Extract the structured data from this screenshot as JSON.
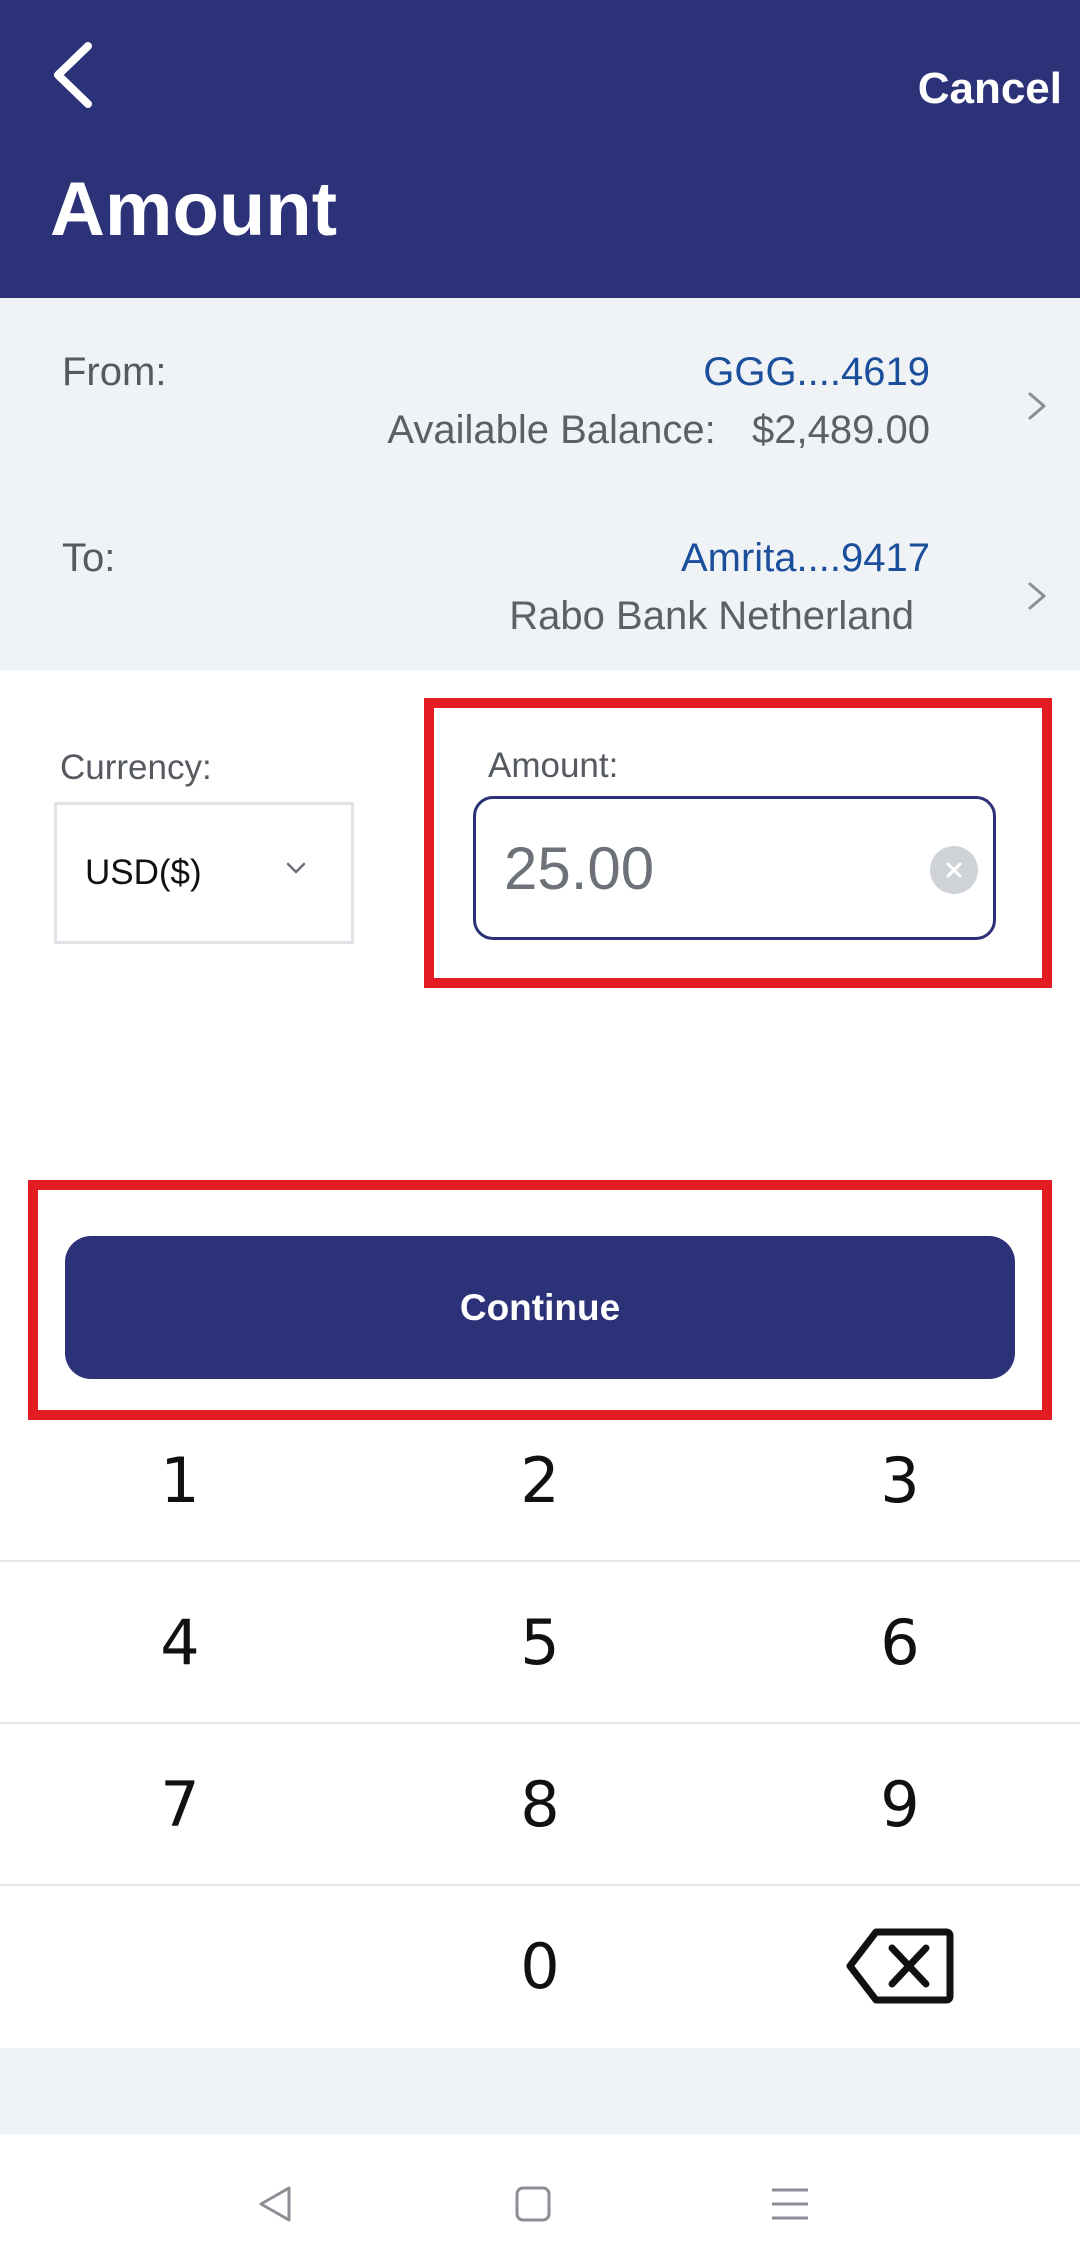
{
  "header": {
    "back_icon": "chevron-left-icon",
    "cancel_label": "Cancel",
    "title": "Amount"
  },
  "from_account": {
    "label": "From:",
    "account": "GGG....4619",
    "balance_label": "Available Balance:",
    "balance_value": "$2,489.00"
  },
  "to_account": {
    "label": "To:",
    "account": "Amrita....9417",
    "bank": "Rabo Bank Netherland"
  },
  "currency": {
    "label": "Currency:",
    "value": "USD($)"
  },
  "amount": {
    "label": "Amount:",
    "value": "25.00"
  },
  "continue_label": "Continue",
  "keypad": {
    "keys": [
      "1",
      "2",
      "3",
      "4",
      "5",
      "6",
      "7",
      "8",
      "9",
      "",
      "0"
    ],
    "backspace_icon": "backspace-icon"
  },
  "system_nav": {
    "back_icon": "nav-back-triangle-icon",
    "home_icon": "nav-home-square-icon",
    "menu_icon": "nav-menu-lines-icon"
  },
  "colors": {
    "brand_navy": "#2b3277",
    "link_blue": "#1b4f9b",
    "highlight_red": "#e31c23",
    "panel_gray": "#f0f3f6"
  }
}
